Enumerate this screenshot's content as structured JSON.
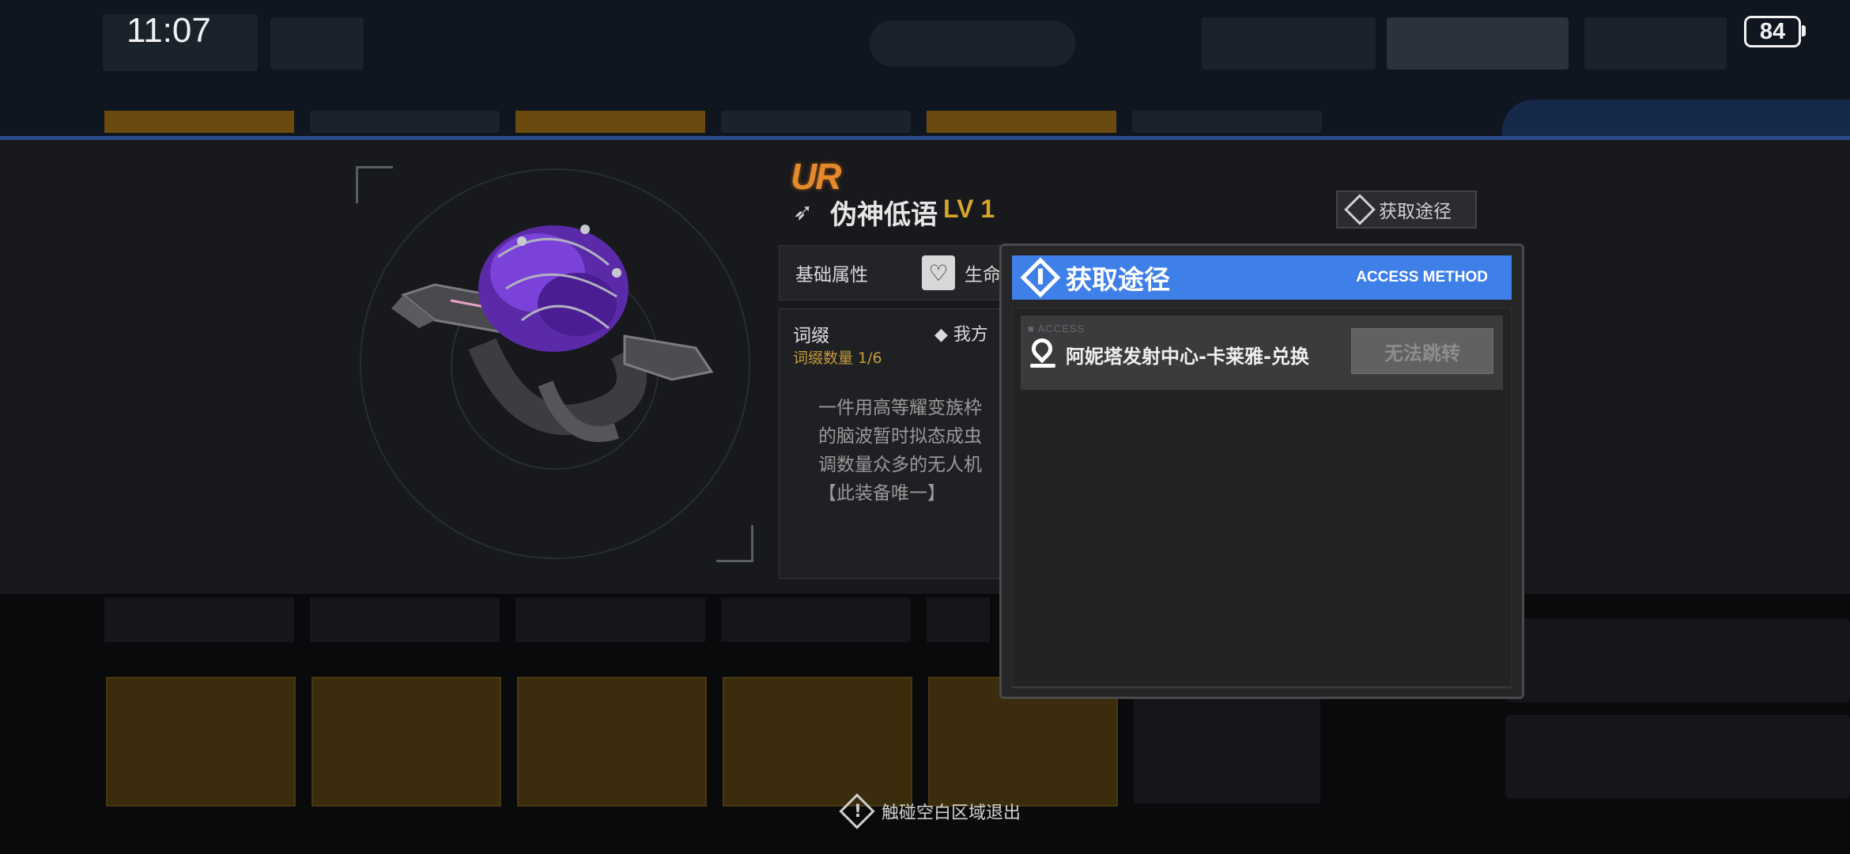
{
  "status_bar": {
    "time": "11:07",
    "battery": "84"
  },
  "item": {
    "rarity": "UR",
    "name": "伪神低语",
    "level": "LV 1",
    "access_button": "获取途径",
    "stats": {
      "label": "基础属性",
      "value_partial": "生命"
    },
    "affix": {
      "title": "词缀",
      "count": "词缀数量 1/6",
      "side_partial": "我方"
    },
    "description": "一件用高等耀变族枠\n的脑波暂时拟态成虫\n调数量众多的无人机\n【此装备唯一】"
  },
  "modal": {
    "title": "获取途径",
    "subtitle": "ACCESS METHOD",
    "route_tag": "ACCESS",
    "routes": [
      {
        "label": "阿妮塔发射中心-卡莱雅-兑换",
        "button": "无法跳转"
      }
    ]
  },
  "exit_hint": "触碰空白区域退出",
  "colors": {
    "accent": "#3e7fe8",
    "rarity": "#e58a2a",
    "level": "#d7a52e",
    "affix_count": "#c89b3c"
  },
  "icons": [
    "battery-icon",
    "weapon-type-icon",
    "access-diamond-icon",
    "heart-icon",
    "location-pin-icon",
    "warning-diamond-icon"
  ]
}
